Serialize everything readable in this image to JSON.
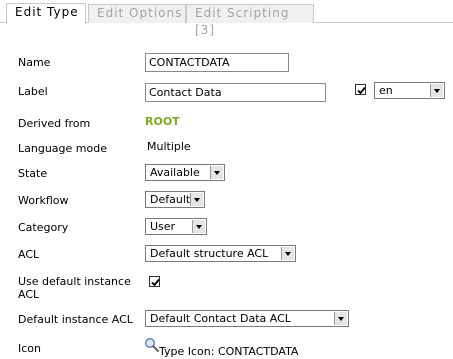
{
  "tabs": [
    {
      "label": "Edit Type",
      "active": true
    },
    {
      "label": "Edit Options",
      "active": false
    },
    {
      "label": "Edit Scripting [3]",
      "active": false
    }
  ],
  "form": {
    "name": {
      "label": "Name",
      "value": "CONTACTDATA"
    },
    "label": {
      "label": "Label",
      "value": "Contact Data",
      "multilang_checked": true,
      "language": "en"
    },
    "derived_from": {
      "label": "Derived from",
      "value": "ROOT"
    },
    "language_mode": {
      "label": "Language mode",
      "value": "Multiple"
    },
    "state": {
      "label": "State",
      "value": "Available"
    },
    "workflow": {
      "label": "Workflow",
      "value": "Default"
    },
    "category": {
      "label": "Category",
      "value": "User"
    },
    "acl": {
      "label": "ACL",
      "value": "Default structure ACL"
    },
    "use_default_instance_acl": {
      "label_line1": "Use default instance",
      "label_line2": "ACL",
      "checked": true
    },
    "default_instance_acl": {
      "label": "Default instance ACL",
      "value": "Default Contact Data ACL"
    },
    "icon": {
      "label": "Icon",
      "value": "Type Icon: CONTACTDATA",
      "icon": "magnifier-icon"
    }
  },
  "colors": {
    "derived_value": "#7fa81e",
    "tab_border": "#c9c9c9",
    "tab_inactive_text": "#a3a3a3"
  }
}
